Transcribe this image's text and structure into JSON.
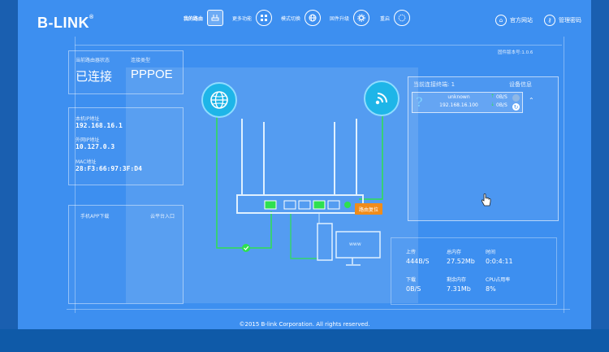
{
  "header": {
    "logo": "B-LINK",
    "nav": [
      {
        "label": "我的路由",
        "icon": "router-icon",
        "active": true
      },
      {
        "label": "更多功能",
        "icon": "grid-icon",
        "active": false
      },
      {
        "label": "模式切换",
        "icon": "globe-icon",
        "active": false
      },
      {
        "label": "固件升级",
        "icon": "gear-icon",
        "active": false
      },
      {
        "label": "重启",
        "icon": "restart-icon",
        "active": false
      }
    ],
    "official_site": "官方网站",
    "admin_password": "管理密码",
    "firmware_version": "固件版本号:1.0.6"
  },
  "status": {
    "router_state_label": "当前路由器状态",
    "router_state": "已连接",
    "conn_type_label": "连接类型",
    "conn_type": "PPPOE"
  },
  "network": {
    "local_ip_label": "本机IP地址",
    "local_ip": "192.168.16.1",
    "wan_ip_label": "外网IP地址",
    "wan_ip": "10.127.0.3",
    "mac_label": "MAC地址",
    "mac": "28:F3:66:97:3F:D4"
  },
  "downloads": {
    "app_label": "手机APP下载",
    "cloud_label": "云平台入口"
  },
  "diagram": {
    "reset_label": "路由复位",
    "www_label": "www"
  },
  "devices": {
    "connected_label": "当前连接终端: 1",
    "info_label": "设备信息",
    "device": {
      "name": "unknown",
      "ip": "192.168.16.100",
      "up": "0B/S",
      "down": "0B/S"
    }
  },
  "stats": {
    "upload_label": "上传",
    "upload": "444B/S",
    "mem_total_label": "总内存",
    "mem_total": "27.52Mb",
    "time_label": "时间",
    "time": "0:0:4:11",
    "download_label": "下载",
    "download": "0B/S",
    "mem_free_label": "剩余内存",
    "mem_free": "7.31Mb",
    "cpu_label": "CPU占用率",
    "cpu": "8%"
  },
  "footer": {
    "copyright": "©2015 B-link Corporation. All rights reserved."
  }
}
